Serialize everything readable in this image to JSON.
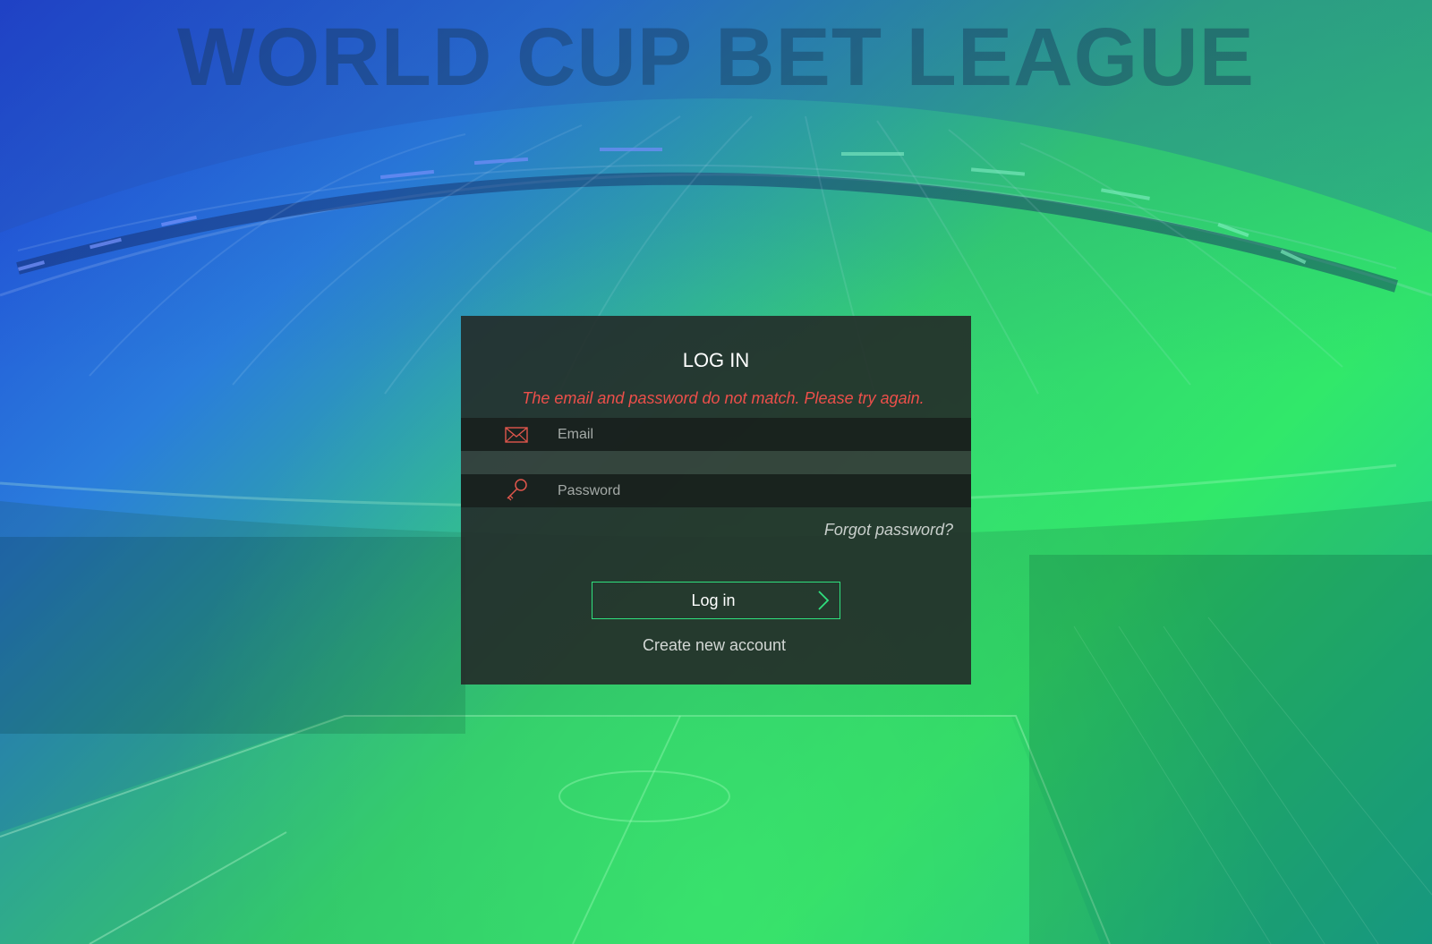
{
  "site": {
    "title": "WORLD CUP BET LEAGUE"
  },
  "login": {
    "heading": "LOG IN",
    "error_message": "The email and password do not match. Please try again.",
    "email": {
      "placeholder": "Email",
      "value": "",
      "icon": "envelope-icon"
    },
    "password": {
      "placeholder": "Password",
      "value": "",
      "icon": "key-icon"
    },
    "forgot_password": "Forgot password?",
    "submit_label": "Log in",
    "submit_icon": "chevron-right-icon",
    "create_account": "Create new account"
  },
  "colors": {
    "error": "#ec4f4a",
    "accent_green": "#2fe07e",
    "icon_red": "#e0564c",
    "panel": "#242a28"
  }
}
